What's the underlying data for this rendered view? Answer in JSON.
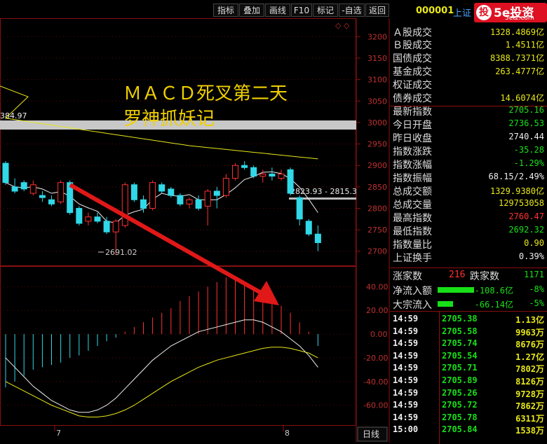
{
  "toolbar": {
    "buttons": [
      "指标",
      "叠加",
      "画线",
      "F10",
      "标记",
      "-自选",
      "返回"
    ]
  },
  "stock_header": {
    "code": "000001",
    "name": "上证"
  },
  "logo": {
    "brand": "5e投资",
    "url": "5etz.com",
    "glyph": "投"
  },
  "chart": {
    "title_line1": "ＭＡＣＤ死叉第二天",
    "title_line2": "罗神抓妖记",
    "left_price_label": "384.97",
    "low_label": "2691.02",
    "range_label": "2823.93 - 2815.3",
    "price_ticks": [
      "3200",
      "3150",
      "3100",
      "3050",
      "3000",
      "2950",
      "2900",
      "2850",
      "2800",
      "2750",
      "2700"
    ],
    "macd_ticks": [
      "40.00",
      "20.00",
      "0.00",
      "-20.00",
      "-40.00",
      "-60.00"
    ],
    "date_labels": [
      "7",
      "8"
    ],
    "period_label": "日线",
    "corner_icons": "◇ ◇"
  },
  "chart_data": {
    "type": "candlestick",
    "price_range": [
      2680,
      3230
    ],
    "candles": [
      {
        "o": 2905,
        "c": 2860,
        "h": 2910,
        "l": 2855
      },
      {
        "o": 2850,
        "c": 2840,
        "h": 2870,
        "l": 2835
      },
      {
        "o": 2860,
        "c": 2845,
        "h": 2865,
        "l": 2840
      },
      {
        "o": 2835,
        "c": 2855,
        "h": 2865,
        "l": 2830
      },
      {
        "o": 2830,
        "c": 2825,
        "h": 2840,
        "l": 2815
      },
      {
        "o": 2820,
        "c": 2810,
        "h": 2830,
        "l": 2805
      },
      {
        "o": 2815,
        "c": 2860,
        "h": 2865,
        "l": 2810
      },
      {
        "o": 2860,
        "c": 2790,
        "h": 2865,
        "l": 2785
      },
      {
        "o": 2800,
        "c": 2765,
        "h": 2805,
        "l": 2760
      },
      {
        "o": 2770,
        "c": 2780,
        "h": 2790,
        "l": 2760
      },
      {
        "o": 2780,
        "c": 2770,
        "h": 2790,
        "l": 2765
      },
      {
        "o": 2770,
        "c": 2745,
        "h": 2780,
        "l": 2740
      },
      {
        "o": 2745,
        "c": 2770,
        "h": 2775,
        "l": 2691
      },
      {
        "o": 2760,
        "c": 2855,
        "h": 2860,
        "l": 2755
      },
      {
        "o": 2855,
        "c": 2820,
        "h": 2860,
        "l": 2815
      },
      {
        "o": 2820,
        "c": 2800,
        "h": 2830,
        "l": 2790
      },
      {
        "o": 2800,
        "c": 2860,
        "h": 2865,
        "l": 2795
      },
      {
        "o": 2855,
        "c": 2840,
        "h": 2860,
        "l": 2835
      },
      {
        "o": 2845,
        "c": 2830,
        "h": 2850,
        "l": 2825
      },
      {
        "o": 2830,
        "c": 2810,
        "h": 2835,
        "l": 2805
      },
      {
        "o": 2810,
        "c": 2820,
        "h": 2825,
        "l": 2800
      },
      {
        "o": 2820,
        "c": 2800,
        "h": 2830,
        "l": 2795
      },
      {
        "o": 2805,
        "c": 2840,
        "h": 2845,
        "l": 2760
      },
      {
        "o": 2840,
        "c": 2830,
        "h": 2850,
        "l": 2800
      },
      {
        "o": 2830,
        "c": 2870,
        "h": 2880,
        "l": 2825
      },
      {
        "o": 2870,
        "c": 2900,
        "h": 2905,
        "l": 2865
      },
      {
        "o": 2900,
        "c": 2895,
        "h": 2910,
        "l": 2890
      },
      {
        "o": 2895,
        "c": 2875,
        "h": 2900,
        "l": 2870
      },
      {
        "o": 2875,
        "c": 2880,
        "h": 2890,
        "l": 2860
      },
      {
        "o": 2880,
        "c": 2875,
        "h": 2895,
        "l": 2865
      },
      {
        "o": 2870,
        "c": 2880,
        "h": 2890,
        "l": 2865
      },
      {
        "o": 2890,
        "c": 2835,
        "h": 2895,
        "l": 2830
      },
      {
        "o": 2825,
        "c": 2775,
        "h": 2830,
        "l": 2760
      },
      {
        "o": 2770,
        "c": 2740,
        "h": 2775,
        "l": 2735
      },
      {
        "o": 2740,
        "c": 2720,
        "h": 2760,
        "l": 2700
      }
    ],
    "macd_range": [
      -75,
      55
    ]
  },
  "quote": [
    {
      "label": "Ａ股成交",
      "value": "1328.4869亿",
      "color": "yel"
    },
    {
      "label": "Ｂ股成交",
      "value": "1.4511亿",
      "color": "yel"
    },
    {
      "label": "国债成交",
      "value": "8388.7371亿",
      "color": "yel"
    },
    {
      "label": "基金成交",
      "value": "263.4777亿",
      "color": "yel"
    },
    {
      "label": "权证成交",
      "value": "",
      "color": "yel"
    },
    {
      "label": "债券成交",
      "value": "14.6074亿",
      "color": "yel"
    },
    {
      "label": "最新指数",
      "value": "2705.16",
      "color": "grn"
    },
    {
      "label": "今日开盘",
      "value": "2736.53",
      "color": "grn"
    },
    {
      "label": "昨日收盘",
      "value": "2740.44",
      "color": "wht"
    },
    {
      "label": "指数涨跌",
      "value": "-35.28",
      "color": "grn"
    },
    {
      "label": "指数涨幅",
      "value": "-1.29%",
      "color": "grn"
    },
    {
      "label": "指数振幅",
      "value": "68.15/2.49%",
      "color": "wht"
    },
    {
      "label": "总成交额",
      "value": "1329.9380亿",
      "color": "yel"
    },
    {
      "label": "总成交量",
      "value": "129753058",
      "color": "yel"
    },
    {
      "label": "最高指数",
      "value": "2760.47",
      "color": "red"
    },
    {
      "label": "最低指数",
      "value": "2692.32",
      "color": "grn"
    },
    {
      "label": "指数量比",
      "value": "0.90",
      "color": "yel"
    },
    {
      "label": "上证换手",
      "value": "0.39%",
      "color": "wht"
    }
  ],
  "breadth": {
    "up_label": "涨家数",
    "up": "216",
    "down_label": "跌家数",
    "down": "1171"
  },
  "flows": [
    {
      "label": "净流入额",
      "value": "-108.6亿",
      "pct": "-8%",
      "bar": 0.7
    },
    {
      "label": "大宗流入",
      "value": "-66.14亿",
      "pct": "-5%",
      "bar": 0.3
    }
  ],
  "trades": [
    {
      "time": "14:59",
      "price": "2705.38",
      "vol": "1.13亿"
    },
    {
      "time": "14:59",
      "price": "2705.58",
      "vol": "9963万"
    },
    {
      "time": "14:59",
      "price": "2705.74",
      "vol": "8676万"
    },
    {
      "time": "14:59",
      "price": "2705.54",
      "vol": "1.27亿"
    },
    {
      "time": "14:59",
      "price": "2705.71",
      "vol": "7802万"
    },
    {
      "time": "14:59",
      "price": "2705.89",
      "vol": "8126万"
    },
    {
      "time": "14:59",
      "price": "2705.26",
      "vol": "9728万"
    },
    {
      "time": "14:59",
      "price": "2705.72",
      "vol": "7862万"
    },
    {
      "time": "14:59",
      "price": "2705.78",
      "vol": "6311万"
    },
    {
      "time": "15:00",
      "price": "2705.84",
      "vol": "1538万"
    }
  ]
}
